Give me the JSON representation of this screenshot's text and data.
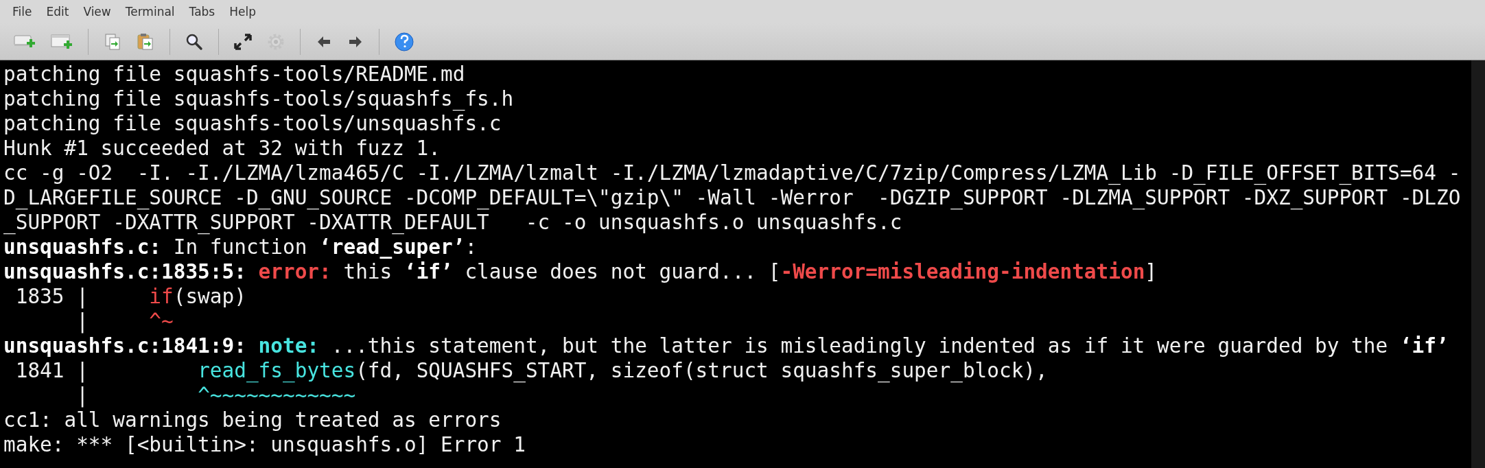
{
  "menu": [
    "File",
    "Edit",
    "View",
    "Terminal",
    "Tabs",
    "Help"
  ],
  "toolbar": [
    {
      "kind": "new-tab",
      "disabled": false
    },
    {
      "kind": "new-window",
      "disabled": false
    },
    {
      "kind": "sep"
    },
    {
      "kind": "copy",
      "disabled": false
    },
    {
      "kind": "paste",
      "disabled": false
    },
    {
      "kind": "sep"
    },
    {
      "kind": "search",
      "disabled": false
    },
    {
      "kind": "sep"
    },
    {
      "kind": "fullscreen",
      "disabled": false
    },
    {
      "kind": "settings",
      "disabled": true
    },
    {
      "kind": "sep"
    },
    {
      "kind": "back",
      "disabled": false
    },
    {
      "kind": "forward",
      "disabled": false
    },
    {
      "kind": "sep"
    },
    {
      "kind": "help",
      "disabled": false
    }
  ],
  "terminal": {
    "lines": [
      [
        {
          "text": "patching file squashfs-tools/README.md",
          "kind": "plain"
        }
      ],
      [
        {
          "text": "patching file squashfs-tools/squashfs_fs.h",
          "kind": "plain"
        }
      ],
      [
        {
          "text": "patching file squashfs-tools/unsquashfs.c",
          "kind": "plain"
        }
      ],
      [
        {
          "text": "Hunk #1 succeeded at 32 with fuzz 1.",
          "kind": "plain"
        }
      ],
      [
        {
          "text": "cc -g -O2  -I. -I./LZMA/lzma465/C -I./LZMA/lzmalt -I./LZMA/lzmadaptive/C/7zip/Compress/LZMA_Lib -D_FILE_OFFSET_BITS=64 -",
          "kind": "plain"
        }
      ],
      [
        {
          "text": "D_LARGEFILE_SOURCE -D_GNU_SOURCE -DCOMP_DEFAULT=\\\"gzip\\\" -Wall -Werror  -DGZIP_SUPPORT -DLZMA_SUPPORT -DXZ_SUPPORT -DLZO",
          "kind": "plain"
        }
      ],
      [
        {
          "text": "_SUPPORT -DXATTR_SUPPORT -DXATTR_DEFAULT   -c -o unsquashfs.o unsquashfs.c",
          "kind": "plain"
        }
      ],
      [
        {
          "text": "unsquashfs.c:",
          "kind": "bold"
        },
        {
          "text": " In function ",
          "kind": "plain"
        },
        {
          "text": "‘read_super’",
          "kind": "bold"
        },
        {
          "text": ":",
          "kind": "plain"
        }
      ],
      [
        {
          "text": "unsquashfs.c:1835:5: ",
          "kind": "bold"
        },
        {
          "text": "error:",
          "kind": "error_bold"
        },
        {
          "text": " this ",
          "kind": "plain"
        },
        {
          "text": "‘if’",
          "kind": "bold"
        },
        {
          "text": " clause does not guard... [",
          "kind": "plain"
        },
        {
          "text": "-Werror=misleading-indentation",
          "kind": "error_bold"
        },
        {
          "text": "]",
          "kind": "plain"
        }
      ],
      [
        {
          "text": " 1835 |     ",
          "kind": "plain"
        },
        {
          "text": "if",
          "kind": "error"
        },
        {
          "text": "(swap)",
          "kind": "plain"
        }
      ],
      [
        {
          "text": "      |     ",
          "kind": "plain"
        },
        {
          "text": "^~",
          "kind": "error"
        }
      ],
      [
        {
          "text": "unsquashfs.c:1841:9: ",
          "kind": "bold"
        },
        {
          "text": "note:",
          "kind": "note_bold"
        },
        {
          "text": " ...this statement, but the latter is misleadingly indented as if it were guarded by the ",
          "kind": "plain"
        },
        {
          "text": "‘if’",
          "kind": "bold"
        }
      ],
      [
        {
          "text": " 1841 |         ",
          "kind": "plain"
        },
        {
          "text": "read_fs_bytes",
          "kind": "note"
        },
        {
          "text": "(fd, SQUASHFS_START, sizeof(struct squashfs_super_block),",
          "kind": "plain"
        }
      ],
      [
        {
          "text": "      |         ",
          "kind": "plain"
        },
        {
          "text": "^~~~~~~~~~~~~",
          "kind": "note"
        }
      ],
      [
        {
          "text": "cc1: all warnings being treated as errors",
          "kind": "plain"
        }
      ],
      [
        {
          "text": "make: *** [<builtin>: unsquashfs.o] Error 1",
          "kind": "plain"
        }
      ]
    ]
  }
}
